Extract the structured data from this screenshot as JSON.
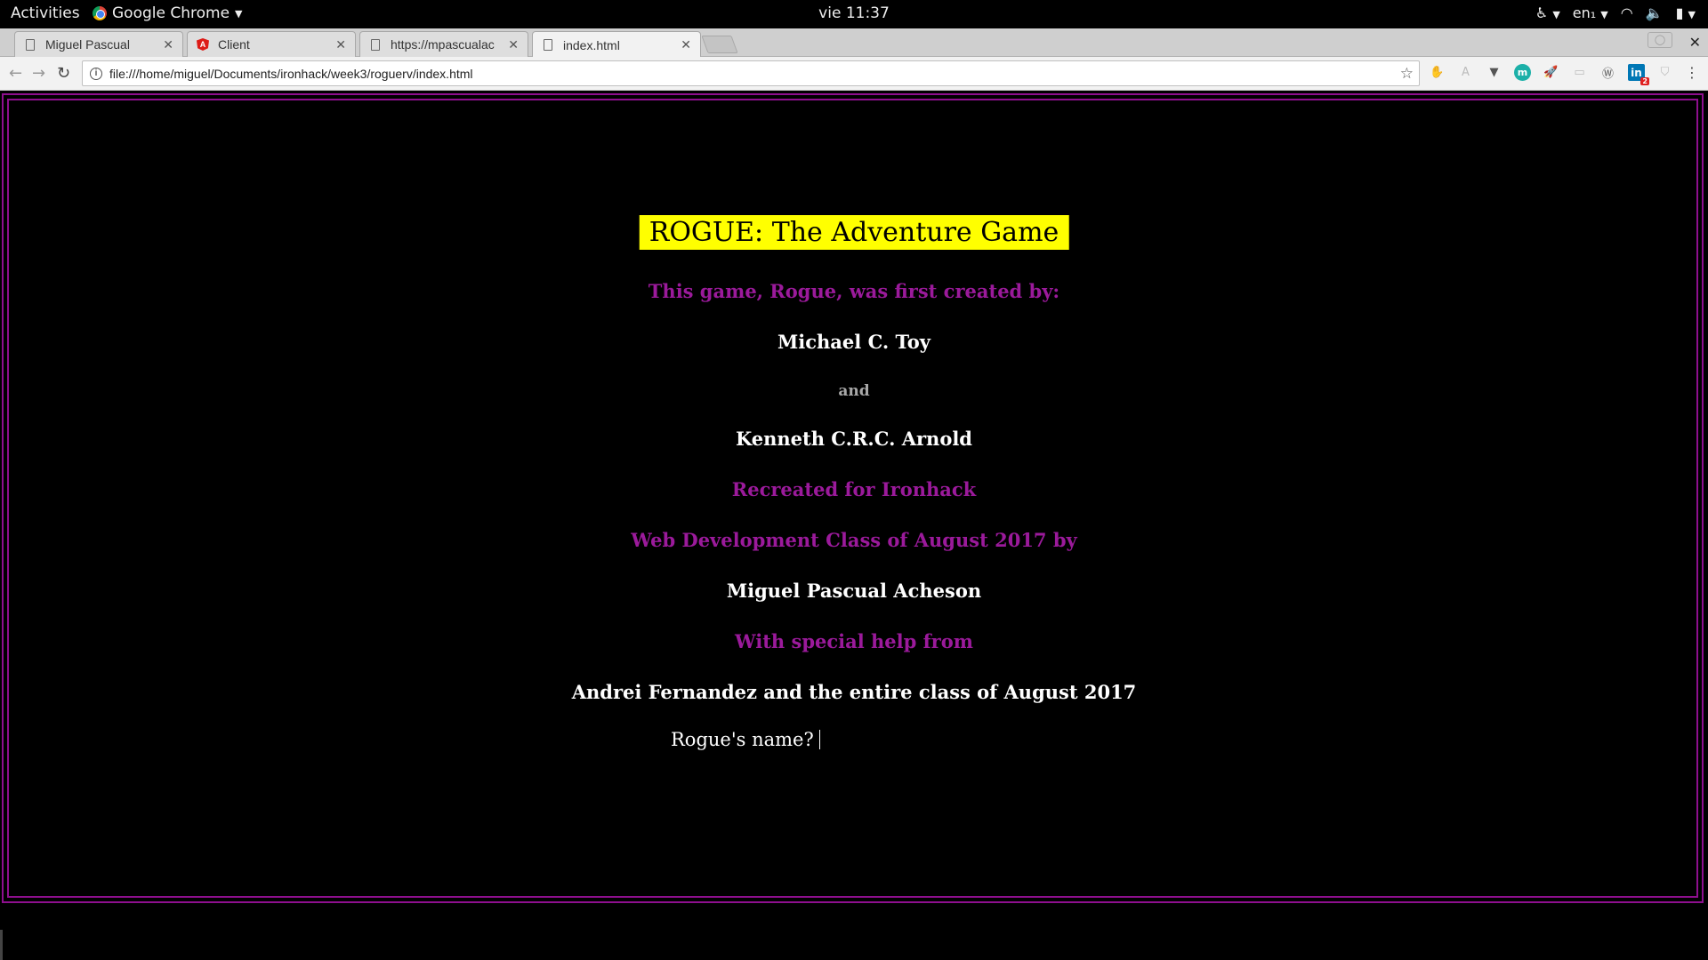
{
  "system": {
    "activities": "Activities",
    "app_name": "Google Chrome",
    "clock": "vie 11:37",
    "keyboard": "en₁"
  },
  "tabs": [
    {
      "title": "Miguel Pascual",
      "icon": "document-icon"
    },
    {
      "title": "Client",
      "icon": "angular-icon"
    },
    {
      "title": "https://mpascualac",
      "icon": "document-icon"
    },
    {
      "title": "index.html",
      "icon": "document-icon",
      "active": true
    }
  ],
  "toolbar": {
    "url": "file:///home/miguel/Documents/ironhack/week3/roguerv/index.html"
  },
  "page": {
    "title": "ROGUE: The Adventure Game",
    "created_by": "This game, Rogue, was first created by:",
    "author1": "Michael C. Toy",
    "and": "and",
    "author2": "Kenneth C.R.C. Arnold",
    "recreated": "Recreated for Ironhack",
    "class": "Web Development Class of August 2017 by",
    "recreator": "Miguel Pascual Acheson",
    "special_help": "With special help from",
    "helpers": "Andrei Fernandez and the entire class of August 2017",
    "prompt": "Rogue's name?"
  },
  "colors": {
    "frame": "#8e0f8e",
    "purple_text": "#9b1a9b",
    "title_bg": "#ffff00"
  }
}
